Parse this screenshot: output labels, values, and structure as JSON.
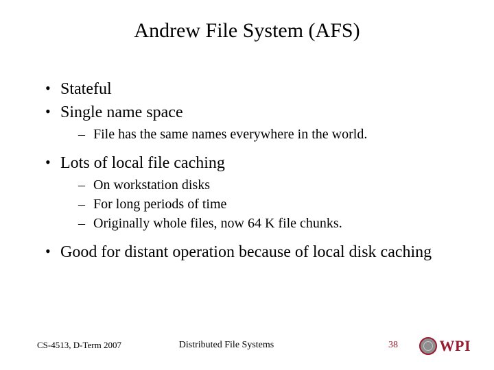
{
  "title": "Andrew File System (AFS)",
  "bullets": [
    {
      "text": "Stateful",
      "sub": []
    },
    {
      "text": "Single name space",
      "sub": [
        "File has the same names everywhere in the world."
      ]
    },
    {
      "text": "Lots of local file caching",
      "sub": [
        "On workstation disks",
        "For long periods of time",
        "Originally whole files, now 64 K file chunks."
      ]
    },
    {
      "text": "Good for distant operation because of local disk caching",
      "sub": []
    }
  ],
  "footer": {
    "left": "CS-4513, D-Term 2007",
    "center": "Distributed File Systems",
    "page": "38",
    "logo_text": "WPI"
  }
}
